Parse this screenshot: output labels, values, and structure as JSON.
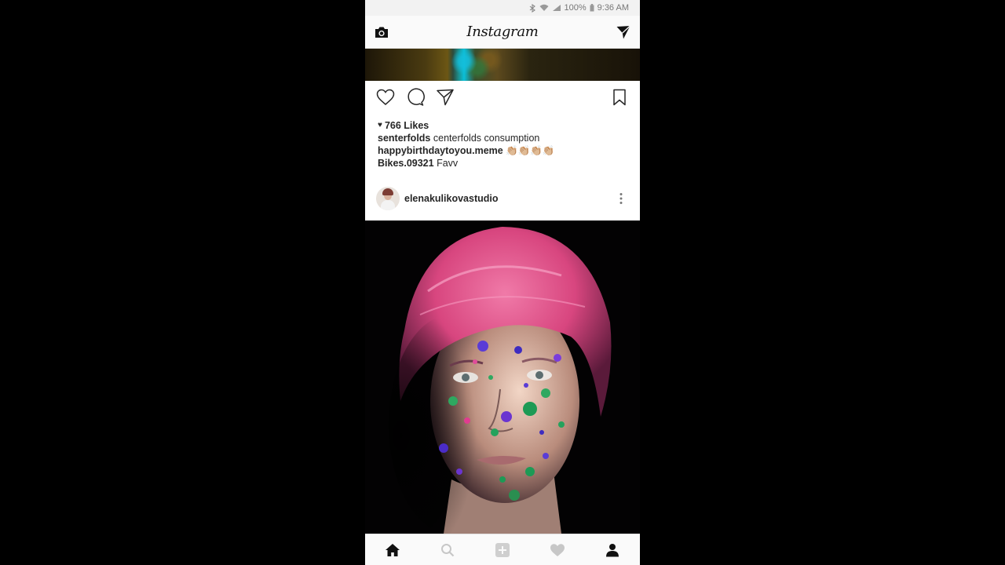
{
  "status_bar": {
    "battery": "100%",
    "time": "9:36 AM"
  },
  "header": {
    "brand": "Instagram"
  },
  "post": {
    "likes": "766 Likes",
    "captions": [
      {
        "user": "senterfolds",
        "text": "centerfolds consumption"
      },
      {
        "user": "happybirthdaytoyou.meme",
        "text": "👏🏼👏🏼👏🏼👏🏼"
      },
      {
        "user": "Bikes.09321",
        "text": "Favv"
      }
    ]
  },
  "next_post": {
    "username": "elenakulikovastudio"
  },
  "icons": {
    "top_left": "camera-icon",
    "top_right": "direct-message-icon",
    "actions": [
      "heart-icon",
      "comment-icon",
      "share-icon",
      "bookmark-icon"
    ],
    "bottom_nav": [
      "home-icon",
      "search-icon",
      "add-icon",
      "activity-heart-icon",
      "profile-icon"
    ]
  },
  "colors": {
    "text": "#262626",
    "nav_bg": "#fafafa",
    "inactive_icon": "#c7c7c7"
  }
}
